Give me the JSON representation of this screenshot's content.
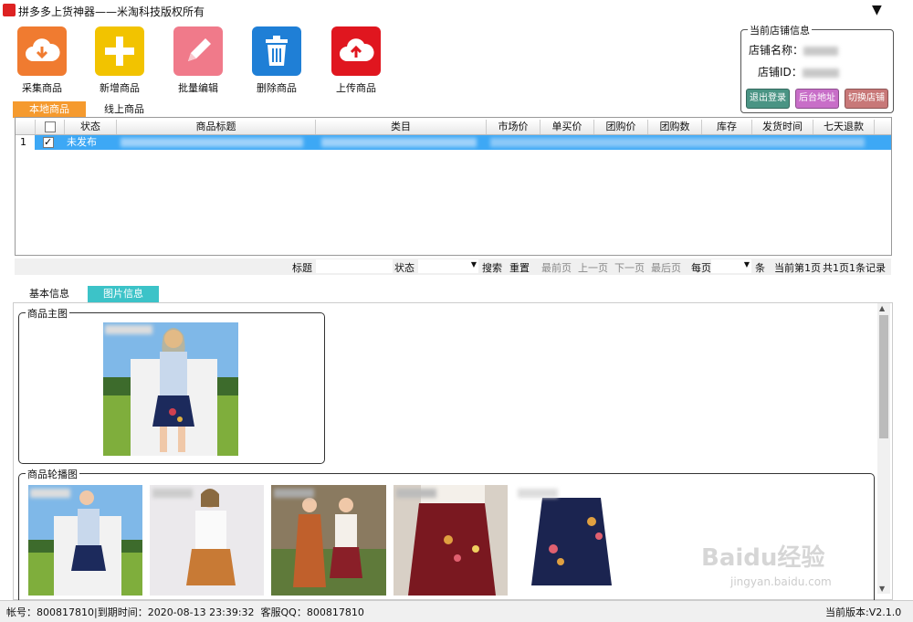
{
  "window": {
    "title": "拼多多上货神器——米淘科技版权所有"
  },
  "toolbar": {
    "collect_label": "采集商品",
    "add_label": "新增商品",
    "batch_edit_label": "批量编辑",
    "delete_label": "删除商品",
    "upload_label": "上传商品"
  },
  "shop": {
    "legend": "当前店铺信息",
    "name_label": "店铺名称：",
    "id_label": "店铺ID：",
    "logout_label": "退出登录",
    "backend_label": "后台地址",
    "switch_label": "切换店铺"
  },
  "tabs": {
    "local": "本地商品",
    "online": "线上商品"
  },
  "grid": {
    "headers": {
      "status": "状态",
      "title": "商品标题",
      "category": "类目",
      "market_price": "市场价",
      "single_price": "单买价",
      "group_price": "团购价",
      "group_count": "团购数",
      "stock": "库存",
      "ship_time": "发货时间",
      "refund": "七天退款"
    },
    "rows": [
      {
        "index": "1",
        "checked": true,
        "status": "未发布"
      }
    ]
  },
  "pager": {
    "title_label": "标题",
    "status_label": "状态",
    "search_label": "搜索",
    "reset_label": "重置",
    "first_label": "最前页",
    "prev_label": "上一页",
    "next_label": "下一页",
    "last_label": "最后页",
    "per_page_label": "每页",
    "unit_label": "条",
    "current_text": "当前第1页",
    "total_text": "共1页1条记录"
  },
  "detail_tabs": {
    "basic": "基本信息",
    "image": "图片信息"
  },
  "detail": {
    "main_image_legend": "商品主图",
    "carousel_legend": "商品轮播图"
  },
  "status_bar": {
    "account_text": "帐号：800817810|到期时间：2020-08-13 23:39:32  客服QQ：800817810",
    "version_text": "当前版本:V2.1.0"
  },
  "watermark": {
    "brand": "Baidu经验",
    "url": "jingyan.baidu.com"
  },
  "colors": {
    "collect": "#f07b30",
    "add": "#f2c300",
    "batch_edit": "#f07a8a",
    "delete": "#1f7fd6",
    "upload": "#e0161f",
    "selected_row": "#3da8f5",
    "active_tab": "#f59a2e",
    "image_tab": "#3cc3c8",
    "logout": "#4a9484",
    "backend": "#c86ec8",
    "switch": "#c87878"
  }
}
